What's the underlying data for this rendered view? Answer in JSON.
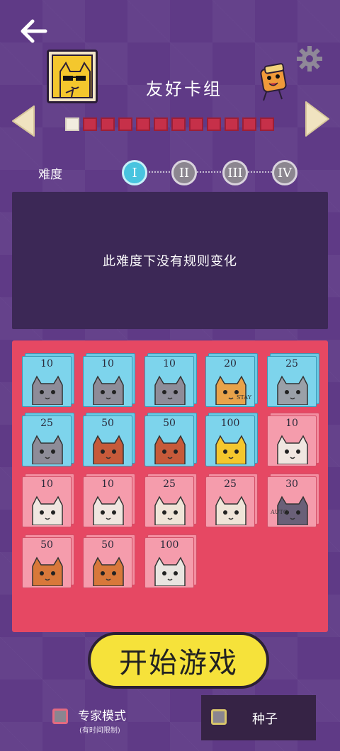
{
  "header": {
    "deck_title": "友好卡组",
    "progress": {
      "total": 12,
      "current": 1
    }
  },
  "difficulty": {
    "label": "难度",
    "levels": [
      "I",
      "II",
      "III",
      "IV"
    ],
    "selected": 0
  },
  "rules": {
    "text": "此难度下没有规则变化"
  },
  "cards": [
    {
      "value": "10",
      "color": "blue",
      "tag": ""
    },
    {
      "value": "10",
      "color": "blue",
      "tag": ""
    },
    {
      "value": "10",
      "color": "blue",
      "tag": ""
    },
    {
      "value": "20",
      "color": "blue",
      "tag": "STAY"
    },
    {
      "value": "25",
      "color": "blue",
      "tag": ""
    },
    {
      "value": "25",
      "color": "blue",
      "tag": ""
    },
    {
      "value": "50",
      "color": "blue",
      "tag": ""
    },
    {
      "value": "50",
      "color": "blue",
      "tag": ""
    },
    {
      "value": "100",
      "color": "blue",
      "tag": ""
    },
    {
      "value": "10",
      "color": "red",
      "tag": ""
    },
    {
      "value": "10",
      "color": "red",
      "tag": ""
    },
    {
      "value": "10",
      "color": "red",
      "tag": ""
    },
    {
      "value": "25",
      "color": "red",
      "tag": ""
    },
    {
      "value": "25",
      "color": "red",
      "tag": ""
    },
    {
      "value": "30",
      "color": "red",
      "tag": "AUTO"
    },
    {
      "value": "50",
      "color": "red",
      "tag": ""
    },
    {
      "value": "50",
      "color": "red",
      "tag": ""
    },
    {
      "value": "100",
      "color": "red",
      "tag": ""
    }
  ],
  "actions": {
    "start_label": "开始游戏"
  },
  "options": {
    "expert_label": "专家模式",
    "expert_sub": "(有时间限制)",
    "seed_label": "种子"
  },
  "colors": {
    "background": "#5f3a86",
    "panel_red": "#e64863",
    "card_blue": "#7dd4ec",
    "card_red": "#f59cac",
    "start_yellow": "#f6e23a",
    "active_node": "#48c4df"
  }
}
